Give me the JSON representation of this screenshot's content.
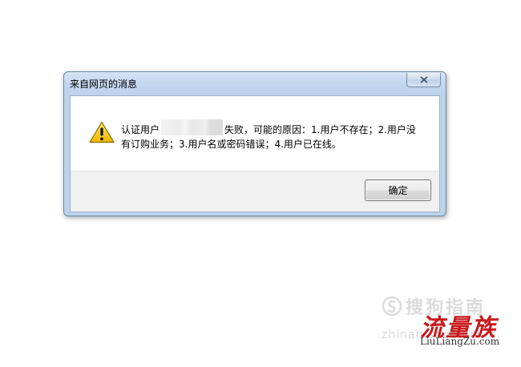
{
  "dialog": {
    "title": "来自网页的消息",
    "message_part1": "认证用户",
    "message_part2": "失败，可能的原因：1.用户不存在；2.用户没",
    "message_line2": "有订购业务；3.用户名或密码错误；4.用户已在线。",
    "ok_label": "确定",
    "icons": {
      "close": "close-icon",
      "warning": "warning-icon"
    }
  },
  "watermarks": {
    "sogou_text": "搜狗指南",
    "sogou_url": "zhinan.sogou.com",
    "llz_text": "流量族",
    "llz_url": "LiuLiangZu.com"
  }
}
